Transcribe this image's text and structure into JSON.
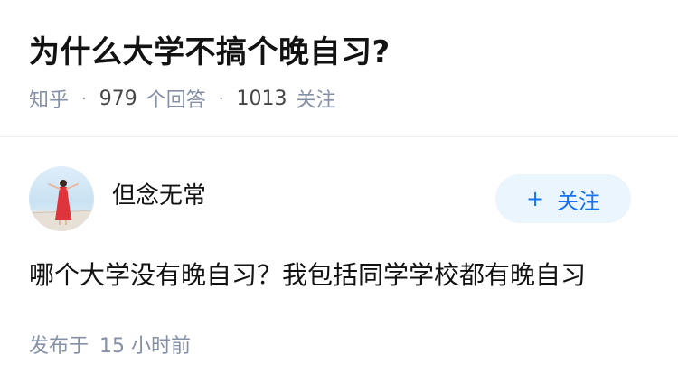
{
  "question": {
    "title": "为什么大学不搞个晚自习?",
    "source": "知乎",
    "answer_count": "979",
    "answer_label": "个回答",
    "follower_count": "1013",
    "follower_label": "关注"
  },
  "author": {
    "name": "但念无常",
    "avatar_icon": "avatar-photo"
  },
  "follow_button": {
    "icon": "+",
    "label": "关注"
  },
  "detail": {
    "text": "哪个大学没有晚自习？我包括同学学校都有晚自习",
    "posted_label": "发布于",
    "posted_time": "15 小时前"
  },
  "colors": {
    "accent": "#1772f6",
    "button_bg": "#ebf5fd",
    "meta": "#8590a6",
    "text": "#121212"
  }
}
